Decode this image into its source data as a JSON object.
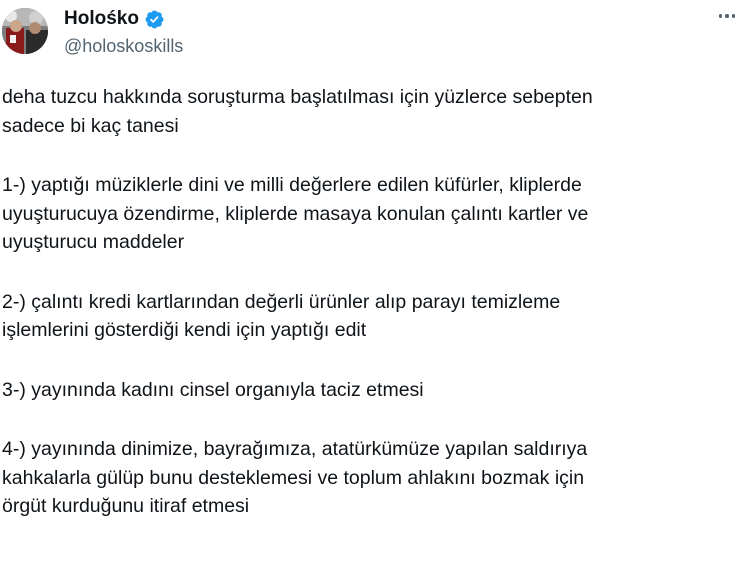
{
  "author": {
    "display_name": "Holośko",
    "handle": "@holoskoskills",
    "verified_icon": "verified-badge-icon",
    "avatar_icon": "profile-avatar"
  },
  "header": {
    "more_icon": "more-options-icon"
  },
  "colors": {
    "text": "#0f1419",
    "secondary": "#536471",
    "verified": "#1d9bf0",
    "background": "#ffffff"
  },
  "tweet": {
    "intro": [
      "deha tuzcu hakkında soruşturma başlatılması için yüzlerce sebepten",
      "sadece bi kaç tanesi"
    ],
    "item1": [
      "1-) yaptığı müziklerle dini ve milli değerlere edilen küfürler, kliplerde",
      "uyuşturucuya özendirme, kliplerde masaya konulan çalıntı kartler ve",
      "uyuşturucu maddeler"
    ],
    "item2": [
      "2-) çalıntı kredi kartlarından değerli ürünler alıp parayı temizleme",
      "işlemlerini gösterdiği kendi için yaptığı edit"
    ],
    "item3": [
      "3-) yayınında kadını cinsel organıyla taciz etmesi"
    ],
    "item4": [
      "4-) yayınında dinimize, bayrağımıza, atatürkümüze yapılan saldırıya",
      "kahkalarla gülüp bunu desteklemesi ve toplum ahlakını bozmak için",
      "örgüt kurduğunu itiraf etmesi"
    ]
  }
}
